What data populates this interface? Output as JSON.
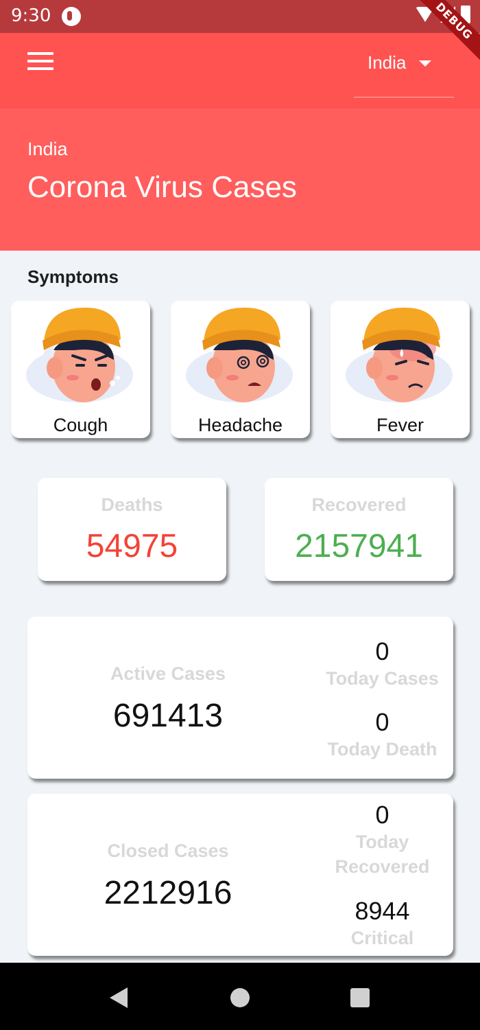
{
  "status_bar": {
    "time": "9:30"
  },
  "debug_banner": "DEBUG",
  "app_bar": {
    "selected_country": "India"
  },
  "header": {
    "country": "India",
    "title": "Corona Virus Cases"
  },
  "symptoms": {
    "heading": "Symptoms",
    "items": [
      {
        "label": "Cough"
      },
      {
        "label": "Headache"
      },
      {
        "label": "Fever"
      }
    ]
  },
  "deaths": {
    "label": "Deaths",
    "value": "54975",
    "color": "#f44336"
  },
  "recovered": {
    "label": "Recovered",
    "value": "2157941",
    "color": "#4caf50"
  },
  "active": {
    "label": "Active Cases",
    "value": "691413",
    "today_cases": {
      "value": "0",
      "label": "Today Cases"
    },
    "today_death": {
      "value": "0",
      "label": "Today Death"
    }
  },
  "closed": {
    "label": "Closed Cases",
    "value": "2212916",
    "today_recovered": {
      "value": "0",
      "label": "Today Recovered"
    },
    "critical": {
      "value": "8944",
      "label": "Critical"
    }
  },
  "colors": {
    "primary": "#ff5352",
    "status_bar": "#b63a3c",
    "background": "#f0f4f8"
  }
}
